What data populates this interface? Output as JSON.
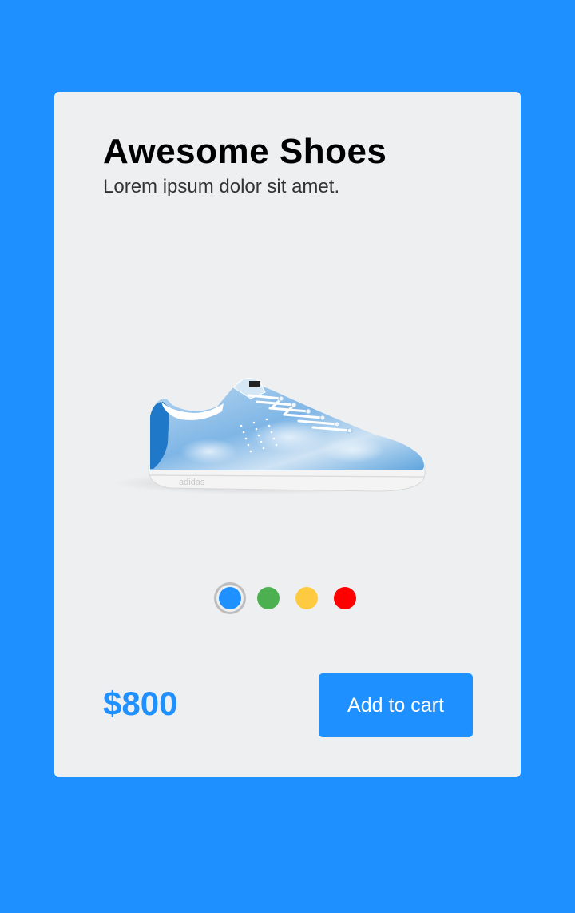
{
  "product": {
    "title": "Awesome Shoes",
    "subtitle": "Lorem ipsum dolor sit amet.",
    "image_icon": "sneaker-image",
    "brand_mark": "adidas",
    "price": "$800"
  },
  "colors": {
    "page_background": "#1e90ff",
    "card_background": "#eeeff1",
    "accent": "#1e90ff"
  },
  "swatches": [
    {
      "name": "blue",
      "color": "#1e90ff",
      "selected": true
    },
    {
      "name": "green",
      "color": "#4caf50",
      "selected": false
    },
    {
      "name": "yellow",
      "color": "#fdca40",
      "selected": false
    },
    {
      "name": "red",
      "color": "#ff0000",
      "selected": false
    }
  ],
  "actions": {
    "add_to_cart_label": "Add to cart"
  }
}
